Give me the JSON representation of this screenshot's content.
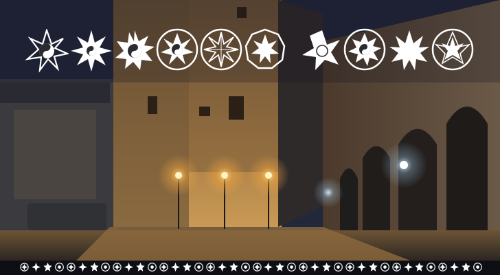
{
  "colors": {
    "sky": "#23283a",
    "stone_lit": "#b98a4a",
    "stone_dark": "#3e3128",
    "lamp": "#ffd46a",
    "glyph": "#ffffff",
    "strip_bg": "#0e0f14"
  },
  "glyphs": {
    "row": [
      "yin-yang-star-icon",
      "eight-point-star-icon",
      "yin-yang-sunburst-icon",
      "circled-yin-yang-star-icon",
      "circled-compass-star-icon",
      "nonagon-star-icon",
      "seven-point-star-icon",
      "circled-yin-yang-burst-icon",
      "nine-point-star-icon",
      "circled-nonagram-icon"
    ],
    "strip_count": 40
  }
}
